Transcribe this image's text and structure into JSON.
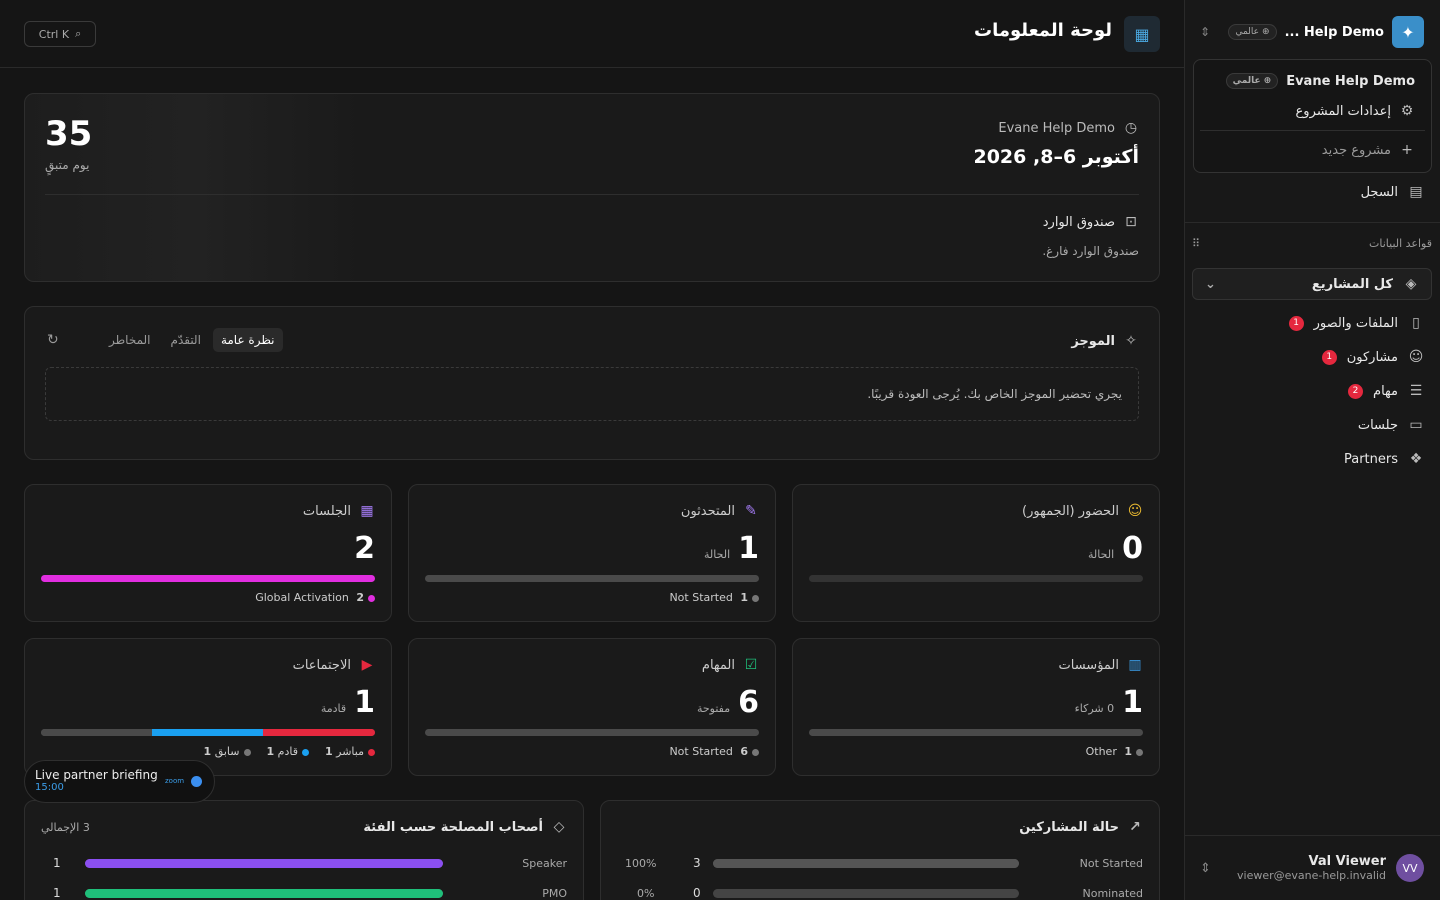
{
  "sidebar": {
    "project_name": "Help Demo ...",
    "global_badge": "عالمي",
    "dropdown": {
      "project": "Evane Help Demo",
      "global_badge": "عالمي",
      "settings": "إعدادات المشروع",
      "new_project": "مشروع جديد"
    },
    "log": "السجل",
    "section_title": "قواعد البيانات",
    "all_projects": "كل المشاريع",
    "nav": [
      {
        "label": "الملفات والصور",
        "count": "1",
        "icon": "file-icon"
      },
      {
        "label": "مشاركون",
        "count": "1",
        "icon": "users-icon"
      },
      {
        "label": "مهام",
        "count": "2",
        "icon": "tasks-icon"
      },
      {
        "label": "جلسات",
        "count": "",
        "icon": "presentation-icon"
      },
      {
        "label": "Partners",
        "count": "",
        "icon": "partners-icon"
      }
    ],
    "user": {
      "initials": "VV",
      "name": "Val Viewer",
      "email": "viewer@evane-help.invalid"
    }
  },
  "topbar": {
    "title": "لوحة المعلومات",
    "search_shortcut": "Ctrl K"
  },
  "event": {
    "name": "Evane Help Demo",
    "date": "أكتوبر 6–8, 2026",
    "days": "35",
    "days_label": "يوم متبقٍ",
    "inbox_title": "صندوق الوارد",
    "inbox_empty": "صندوق الوارد فارغ."
  },
  "briefing": {
    "title": "الموجز",
    "tabs": [
      "نظرة عامة",
      "التقدّم",
      "المخاطر"
    ],
    "message": "يجري تحضير الموجز الخاص بك. يُرجى العودة قريبًا."
  },
  "stats": {
    "sessions": {
      "title": "الجلسات",
      "value": "2",
      "legend": [
        {
          "count": "2",
          "label": "Global Activation",
          "color": "#e12ee0"
        }
      ]
    },
    "speakers": {
      "title": "المتحدثون",
      "value": "1",
      "sub": "الحالة",
      "legend": [
        {
          "count": "1",
          "label": "Not Started",
          "color": "#777"
        }
      ]
    },
    "attendance": {
      "title": "الحضور (الجمهور)",
      "value": "0",
      "sub": "الحالة"
    },
    "meetings": {
      "title": "الاجتماعات",
      "value": "1",
      "sub": "قادمة",
      "legend": [
        {
          "count": "1",
          "label": "مباشر",
          "color": "#e5283e"
        },
        {
          "count": "1",
          "label": "قادم",
          "color": "#1aa0f0"
        },
        {
          "count": "1",
          "label": "سابق",
          "color": "#777"
        }
      ]
    },
    "tasks": {
      "title": "المهام",
      "value": "6",
      "sub": "مفتوحة",
      "legend": [
        {
          "count": "6",
          "label": "Not Started",
          "color": "#777"
        }
      ]
    },
    "orgs": {
      "title": "المؤسسات",
      "value": "1",
      "sub": "0 شركاء",
      "legend": [
        {
          "count": "1",
          "label": "Other",
          "color": "#777"
        }
      ]
    }
  },
  "stakeholders": {
    "title": "أصحاب المصلحة حسب الفئة",
    "total": "3 الإجمالي",
    "rows": [
      {
        "label": "Speaker",
        "value": "1",
        "color": "#8b4ff0"
      },
      {
        "label": "PMO",
        "value": "1",
        "color": "#1fbf7a"
      }
    ]
  },
  "participants": {
    "title": "حالة المشاركين",
    "rows": [
      {
        "label": "Not Started",
        "value": "3",
        "pct": "100%",
        "fraction": 1.0
      },
      {
        "label": "Nominated",
        "value": "0",
        "pct": "0%",
        "fraction": 0
      }
    ]
  },
  "live": {
    "title": "Live partner briefing",
    "time": "15:00",
    "provider": "zoom"
  }
}
